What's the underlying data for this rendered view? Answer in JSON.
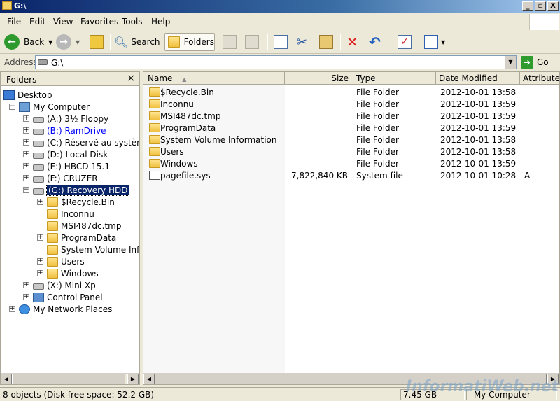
{
  "window": {
    "title": "G:\\",
    "minimize": "_",
    "maximize": "▫",
    "close": "X"
  },
  "menu": [
    "File",
    "Edit",
    "View",
    "Favorites",
    "Tools",
    "Help"
  ],
  "toolbar": {
    "back": "Back",
    "search": "Search",
    "folders": "Folders"
  },
  "address": {
    "label": "Address",
    "value": "G:\\",
    "go": "Go"
  },
  "folders_pane": {
    "title": "Folders",
    "close": "×",
    "tree": [
      {
        "label": "Desktop",
        "icon": "desktop-icon",
        "expander": ""
      },
      {
        "label": "My Computer",
        "icon": "my-computer-icon",
        "expander": "−"
      },
      {
        "label": "(A:) 3½ Floppy",
        "icon": "floppy-drive-icon",
        "expander": "+"
      },
      {
        "label": "(B:) RamDrive",
        "icon": "drive-icon",
        "expander": "+"
      },
      {
        "label": "(C:) Réservé au système",
        "icon": "drive-icon",
        "expander": "+"
      },
      {
        "label": "(D:) Local Disk",
        "icon": "drive-icon",
        "expander": "+"
      },
      {
        "label": "(E:) HBCD 15.1",
        "icon": "cd-drive-icon",
        "expander": "+"
      },
      {
        "label": "(F:) CRUZER",
        "icon": "drive-icon",
        "expander": "+"
      },
      {
        "label": "(G:) Recovery HDD",
        "icon": "drive-icon",
        "expander": "−"
      },
      {
        "label": "$Recycle.Bin",
        "icon": "folder-icon",
        "expander": "+"
      },
      {
        "label": "Inconnu",
        "icon": "folder-icon",
        "expander": ""
      },
      {
        "label": "MSI487dc.tmp",
        "icon": "folder-icon",
        "expander": ""
      },
      {
        "label": "ProgramData",
        "icon": "folder-icon",
        "expander": "+"
      },
      {
        "label": "System Volume Informati",
        "icon": "folder-icon",
        "expander": ""
      },
      {
        "label": "Users",
        "icon": "folder-icon",
        "expander": "+"
      },
      {
        "label": "Windows",
        "icon": "folder-icon",
        "expander": "+"
      },
      {
        "label": "(X:) Mini Xp",
        "icon": "drive-icon",
        "expander": "+"
      },
      {
        "label": "Control Panel",
        "icon": "control-panel-icon",
        "expander": "+"
      },
      {
        "label": "My Network Places",
        "icon": "network-icon",
        "expander": "+"
      }
    ]
  },
  "columns": {
    "name": "Name",
    "size": "Size",
    "type": "Type",
    "date": "Date Modified",
    "attributes": "Attributes"
  },
  "files": [
    {
      "name": "$Recycle.Bin",
      "size": "",
      "type": "File Folder",
      "date": "2012-10-01 13:58",
      "attr": ""
    },
    {
      "name": "Inconnu",
      "size": "",
      "type": "File Folder",
      "date": "2012-10-01 13:59",
      "attr": ""
    },
    {
      "name": "MSI487dc.tmp",
      "size": "",
      "type": "File Folder",
      "date": "2012-10-01 13:59",
      "attr": ""
    },
    {
      "name": "ProgramData",
      "size": "",
      "type": "File Folder",
      "date": "2012-10-01 13:59",
      "attr": ""
    },
    {
      "name": "System Volume Information",
      "size": "",
      "type": "File Folder",
      "date": "2012-10-01 13:58",
      "attr": ""
    },
    {
      "name": "Users",
      "size": "",
      "type": "File Folder",
      "date": "2012-10-01 13:58",
      "attr": ""
    },
    {
      "name": "Windows",
      "size": "",
      "type": "File Folder",
      "date": "2012-10-01 13:59",
      "attr": ""
    },
    {
      "name": "pagefile.sys",
      "size": "7,822,840 KB",
      "type": "System file",
      "date": "2012-10-01 10:28",
      "attr": "A"
    }
  ],
  "status": {
    "left": "8 objects (Disk free space: 52.2 GB)",
    "size": "7.45 GB",
    "location": "My Computer"
  },
  "watermark": "InformatiWeb.net"
}
